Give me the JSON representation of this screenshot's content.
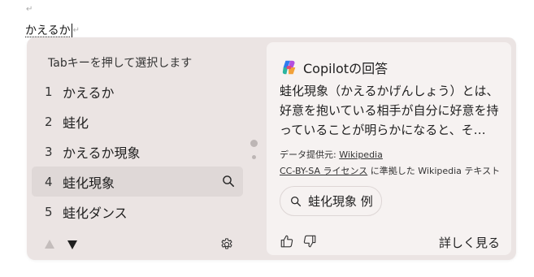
{
  "document": {
    "typed_text": "かえるか",
    "paragraph_mark": "↵"
  },
  "ime": {
    "hint": "Tabキーを押して選択します",
    "candidates": [
      {
        "num": "1",
        "text": "かえるか"
      },
      {
        "num": "2",
        "text": "蛙化"
      },
      {
        "num": "3",
        "text": "かえるか現象"
      },
      {
        "num": "4",
        "text": "蛙化現象"
      },
      {
        "num": "5",
        "text": "蛙化ダンス"
      }
    ],
    "selected_index": 4
  },
  "copilot": {
    "title": "Copilotの回答",
    "description": "蛙化現象（かえるかげんしょう）とは、好意を抱いている相手が自分に好意を持っていることが明らかになると、そ…",
    "provider_prefix": "データ提供元: ",
    "provider_link": "Wikipedia",
    "license_link": "CC-BY-SA ライセンス",
    "license_suffix": " に準拠した Wikipedia テキスト",
    "search_chip": "蛙化現象 例",
    "more": "詳しく見る"
  },
  "colors": {
    "panel_bg": "#ebe4e3",
    "card_bg": "#f6f2f1",
    "selected_bg": "#dfd8d7"
  }
}
